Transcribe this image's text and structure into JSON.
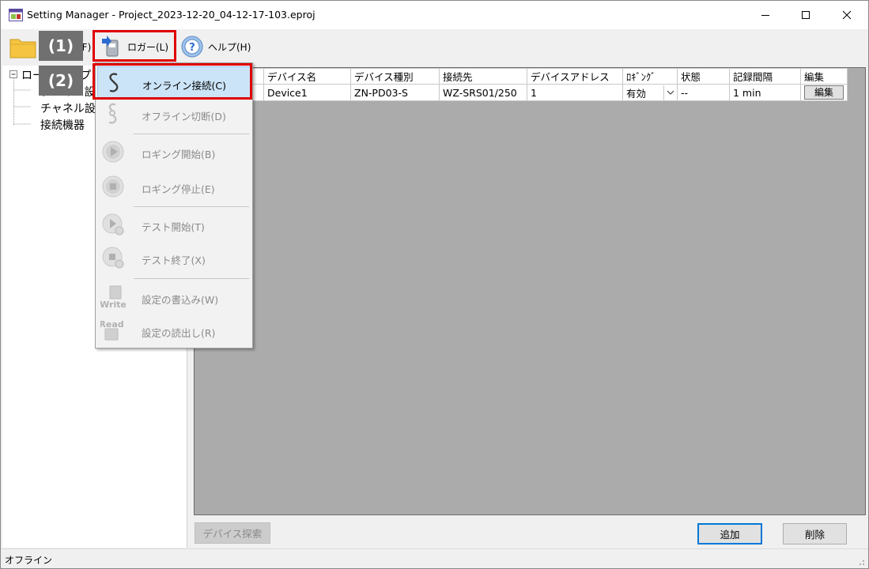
{
  "window": {
    "title": "Setting Manager - Project_2023-12-20_04-12-17-103.eproj"
  },
  "toolbar": {
    "file_label": "ファイル(F)",
    "logger_label": "ロガー(L)",
    "help_label": "ヘルプ(H)"
  },
  "tree": {
    "root": "ローカルPCプロジェクト",
    "items": [
      "デバイス設定",
      "チャネル設定",
      "接続機器"
    ]
  },
  "grid": {
    "headers": [
      "",
      "デバイス名",
      "デバイス種別",
      "接続先",
      "デバイスアドレス",
      "ﾛｷﾞﾝｸﾞ",
      "状態",
      "記録間隔",
      "編集"
    ],
    "rows": [
      {
        "check": "",
        "device_name": "Device1",
        "device_type": "ZN-PD03-S",
        "connection": "WZ-SRS01/250",
        "address": "1",
        "logging": "有効",
        "state": "--",
        "interval": "1 min",
        "edit": "編集"
      }
    ]
  },
  "buttons": {
    "search": "デバイス探索",
    "add": "追加",
    "delete": "削除"
  },
  "status": {
    "text": "オフライン"
  },
  "menu": {
    "items": [
      {
        "label": "オンライン接続(C)",
        "icon": "online-connect-icon",
        "state": "active"
      },
      {
        "label": "オフライン切断(D)",
        "icon": "offline-disconnect-icon",
        "state": "disabled"
      },
      {
        "label": "ロギング開始(B)",
        "icon": "play-icon",
        "state": "disabled"
      },
      {
        "label": "ロギング停止(E)",
        "icon": "stop-icon",
        "state": "disabled"
      },
      {
        "label": "テスト開始(T)",
        "icon": "test-start-icon",
        "state": "disabled"
      },
      {
        "label": "テスト終了(X)",
        "icon": "test-end-icon",
        "state": "disabled"
      },
      {
        "label": "設定の書込み(W)",
        "icon": "write-icon",
        "icon_text": "Write",
        "state": "disabled"
      },
      {
        "label": "設定の読出し(R)",
        "icon": "read-icon",
        "icon_text": "Read",
        "state": "disabled"
      }
    ]
  },
  "annotations": {
    "step1": "(1)",
    "step2": "(2)"
  },
  "colors": {
    "highlight_red": "#e00000",
    "menu_active": "#cce4f7",
    "grid_background": "#ababab",
    "badge_gray": "#707070"
  }
}
